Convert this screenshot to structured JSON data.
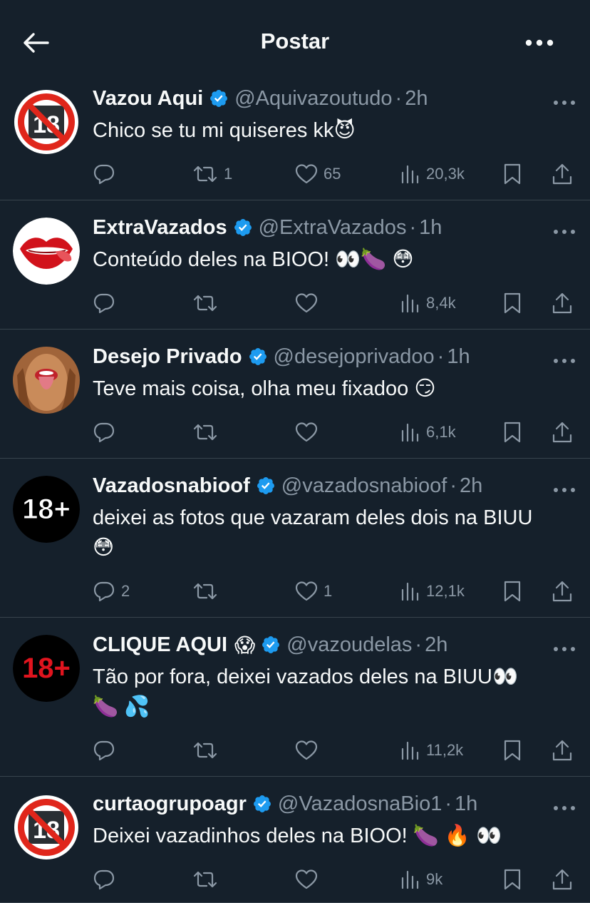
{
  "header": {
    "title": "Postar"
  },
  "tweets": [
    {
      "name": "Vazou Aqui",
      "handle": "@Aquivazoutudo",
      "dot": "·",
      "time": "2h",
      "text": "Chico se tu mi quiseres kk😈",
      "replies": "",
      "retweets": "1",
      "likes": "65",
      "views": "20,3k",
      "avatar": "no-18-icon"
    },
    {
      "name": "ExtraVazados",
      "handle": "@ExtraVazados",
      "dot": "·",
      "time": "1h",
      "text": "Conteúdo deles na BIOO! 👀🍆 😳",
      "replies": "",
      "retweets": "",
      "likes": "",
      "views": "8,4k",
      "avatar": "lips-icon"
    },
    {
      "name": "Desejo Privado",
      "handle": "@desejoprivadoo",
      "dot": "·",
      "time": "1h",
      "text": "Teve mais coisa, olha meu fixadoo 😏",
      "replies": "",
      "retweets": "",
      "likes": "",
      "views": "6,1k",
      "avatar": "face-photo"
    },
    {
      "name": "Vazadosnabioof",
      "handle": "@vazadosnabioof",
      "dot": "·",
      "time": "2h",
      "text": "deixei as fotos que vazaram deles dois na BIUU\n😳",
      "replies": "2",
      "retweets": "",
      "likes": "1",
      "views": "12,1k",
      "avatar": "18-plus-white"
    },
    {
      "name": "CLIQUE AQUI",
      "name_emoji": "😱",
      "handle": "@vazoudelas",
      "dot": "·",
      "time": "2h",
      "text": "Tão por fora, deixei vazados deles na BIUU👀\n🍆 💦",
      "replies": "",
      "retweets": "",
      "likes": "",
      "views": "11,2k",
      "avatar": "18-plus-red"
    },
    {
      "name": "curtaogrupoagr",
      "handle": "@VazadosnaBio1",
      "dot": "·",
      "time": "1h",
      "text": "Deixei vazadinhos deles na BIOO! 🍆 🔥 👀",
      "replies": "",
      "retweets": "",
      "likes": "",
      "views": "9k",
      "avatar": "no-18-icon"
    }
  ],
  "avatar_labels": {
    "eighteen": "18",
    "eighteen_plus": "18+"
  },
  "colors": {
    "background": "#15202b",
    "text": "#f7f9f9",
    "muted": "#8b98a5",
    "verified": "#1d9bf0",
    "divider": "#38444d"
  }
}
